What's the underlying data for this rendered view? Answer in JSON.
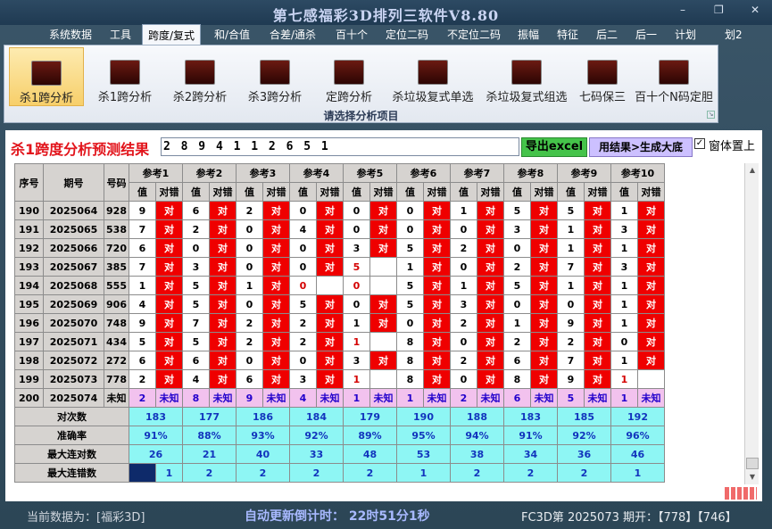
{
  "window": {
    "title": "第七感福彩3D排列三软件V8.80",
    "minimize": "–",
    "restore": "❐",
    "close": "✕"
  },
  "menu": [
    "系统数据",
    "工具",
    "跨度/复式",
    "和/合值",
    "合差/通杀",
    "百十个",
    "定位二码",
    "不定位二码",
    "振幅",
    "特征",
    "后二",
    "后一",
    "计划",
    "划2"
  ],
  "ribbon": {
    "buttons": [
      "杀1跨分析",
      "杀1跨分析",
      "杀2跨分析",
      "杀3跨分析",
      "定跨分析",
      "杀垃圾复式单选",
      "杀垃圾复式组选",
      "七码保三",
      "百十个N码定胆"
    ],
    "caption": "请选择分析项目"
  },
  "result": {
    "title": "杀1跨度分析预测结果",
    "code": "2 8 9 4 1 1 2 6 5 1",
    "excel_button": "导出excel",
    "gen_button": "用结果>生成大底",
    "pin_checkbox": "✓",
    "pin_label": "窗体置上"
  },
  "table": {
    "headers": {
      "seq": "序号",
      "period": "期号",
      "number": "号码",
      "ref_value": "值",
      "ref_hit": "对错"
    },
    "refs": [
      "参考1",
      "参考2",
      "参考3",
      "参考4",
      "参考5",
      "参考6",
      "参考7",
      "参考8",
      "参考9",
      "参考10"
    ],
    "rows": [
      {
        "seq": "190",
        "period": "2025064",
        "number": "928",
        "vals": [
          "9",
          "6",
          "2",
          "0",
          "0",
          "0",
          "1",
          "5",
          "5",
          "1"
        ],
        "hits": [
          true,
          true,
          true,
          true,
          true,
          true,
          true,
          true,
          true,
          true
        ]
      },
      {
        "seq": "191",
        "period": "2025065",
        "number": "538",
        "vals": [
          "7",
          "2",
          "0",
          "4",
          "0",
          "0",
          "0",
          "3",
          "1",
          "3"
        ],
        "hits": [
          true,
          true,
          true,
          true,
          true,
          true,
          true,
          true,
          true,
          true
        ]
      },
      {
        "seq": "192",
        "period": "2025066",
        "number": "720",
        "vals": [
          "6",
          "0",
          "0",
          "0",
          "3",
          "5",
          "2",
          "0",
          "1",
          "1"
        ],
        "hits": [
          true,
          true,
          true,
          true,
          true,
          true,
          true,
          true,
          true,
          true
        ]
      },
      {
        "seq": "193",
        "period": "2025067",
        "number": "385",
        "vals": [
          "7",
          "3",
          "0",
          "0",
          "5",
          "1",
          "0",
          "2",
          "7",
          "3"
        ],
        "hits": [
          true,
          true,
          true,
          true,
          false,
          true,
          true,
          true,
          true,
          true
        ]
      },
      {
        "seq": "194",
        "period": "2025068",
        "number": "555",
        "vals": [
          "1",
          "5",
          "1",
          "0",
          "0",
          "5",
          "1",
          "5",
          "1",
          "1"
        ],
        "hits": [
          true,
          true,
          true,
          false,
          false,
          true,
          true,
          true,
          true,
          true
        ]
      },
      {
        "seq": "195",
        "period": "2025069",
        "number": "906",
        "vals": [
          "4",
          "5",
          "0",
          "5",
          "0",
          "5",
          "3",
          "0",
          "0",
          "1"
        ],
        "hits": [
          true,
          true,
          true,
          true,
          true,
          true,
          true,
          true,
          true,
          true
        ]
      },
      {
        "seq": "196",
        "period": "2025070",
        "number": "748",
        "vals": [
          "9",
          "7",
          "2",
          "2",
          "1",
          "0",
          "2",
          "1",
          "9",
          "1"
        ],
        "hits": [
          true,
          true,
          true,
          true,
          true,
          true,
          true,
          true,
          true,
          true
        ]
      },
      {
        "seq": "197",
        "period": "2025071",
        "number": "434",
        "vals": [
          "5",
          "5",
          "2",
          "2",
          "1",
          "8",
          "0",
          "2",
          "2",
          "0"
        ],
        "hits": [
          true,
          true,
          true,
          true,
          false,
          true,
          true,
          true,
          true,
          true
        ]
      },
      {
        "seq": "198",
        "period": "2025072",
        "number": "272",
        "vals": [
          "6",
          "6",
          "0",
          "0",
          "3",
          "8",
          "2",
          "6",
          "7",
          "1"
        ],
        "hits": [
          true,
          true,
          true,
          true,
          true,
          true,
          true,
          true,
          true,
          true
        ]
      },
      {
        "seq": "199",
        "period": "2025073",
        "number": "778",
        "vals": [
          "2",
          "4",
          "6",
          "3",
          "1",
          "8",
          "0",
          "8",
          "9",
          "1"
        ],
        "hits": [
          true,
          true,
          true,
          true,
          false,
          true,
          true,
          true,
          true,
          false
        ]
      }
    ],
    "future": {
      "seq": "200",
      "period": "2025074",
      "number": "未知",
      "vals": [
        "2",
        "8",
        "9",
        "4",
        "1",
        "1",
        "2",
        "6",
        "5",
        "1"
      ],
      "status": "未知"
    },
    "red_values": [
      {
        "row": 4,
        "ref": 3
      },
      {
        "row": 4,
        "ref": 4
      },
      {
        "row": 3,
        "ref": 4
      },
      {
        "row": 7,
        "ref": 4
      },
      {
        "row": 9,
        "ref": 4
      },
      {
        "row": 9,
        "ref": 9
      }
    ],
    "stats": [
      {
        "label": "对次数",
        "values": [
          "183",
          "177",
          "186",
          "184",
          "179",
          "190",
          "188",
          "183",
          "185",
          "192"
        ]
      },
      {
        "label": "准确率",
        "values": [
          "91%",
          "88%",
          "93%",
          "92%",
          "89%",
          "95%",
          "94%",
          "91%",
          "92%",
          "96%"
        ]
      },
      {
        "label": "最大连对数",
        "values": [
          "26",
          "21",
          "40",
          "33",
          "48",
          "53",
          "38",
          "34",
          "36",
          "46"
        ]
      },
      {
        "label": "最大连错数",
        "values": [
          "1",
          "2",
          "2",
          "2",
          "2",
          "1",
          "2",
          "2",
          "2",
          "1"
        ]
      }
    ],
    "hit_text": "对",
    "colors": {
      "hit": "#ef0000",
      "future": "#f2c2ee",
      "stat": "#8ef6f4",
      "header": "#d6d3d0"
    }
  },
  "scrollbar": {
    "up": "▲",
    "down": "▼"
  },
  "status": {
    "data_label": "当前数据为：[福彩3D]",
    "countdown": "自动更新倒计时：  22时51分1秒",
    "draw_info": "FC3D第 2025073 期开：【778】【746】"
  }
}
